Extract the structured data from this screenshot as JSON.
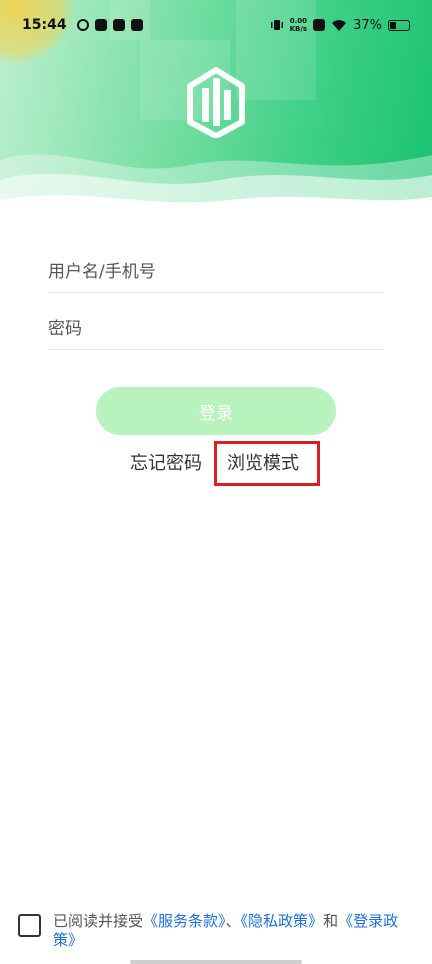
{
  "status_bar": {
    "time": "15:44",
    "net_speed_value": "0.00",
    "net_speed_unit": "KB/s",
    "battery_percent": "37%",
    "battery_level": 0.37
  },
  "form": {
    "username_placeholder": "用户名/手机号",
    "password_placeholder": "密码",
    "login_label": "登录"
  },
  "links": {
    "forgot_password": "忘记密码",
    "browse_mode": "浏览模式"
  },
  "agreement": {
    "prefix": "已阅读并接受",
    "terms": "《服务条款》",
    "sep": "、",
    "privacy": "《隐私政策》",
    "and": "和",
    "login_policy": "《登录政策》"
  },
  "colors": {
    "brand_green": "#19c270",
    "button_green": "#b8f3bd",
    "link_blue": "#1d6fe0",
    "highlight_red": "#d61f26"
  }
}
